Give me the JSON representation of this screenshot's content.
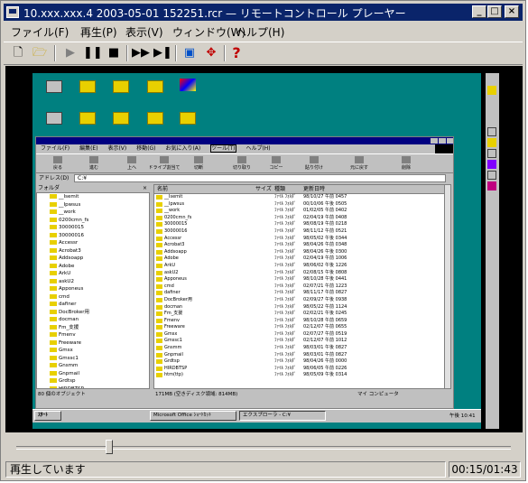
{
  "window": {
    "title": "10.xxx.xxx.4 2003-05-01 152251.rcr — リモートコントロール プレーヤー"
  },
  "menu": [
    "ファイル(F)",
    "再生(P)",
    "表示(V)",
    "ウィンドウ(W)",
    "ヘルプ(H)"
  ],
  "remote": {
    "explorer": {
      "menu": [
        "ファイル(F)",
        "編集(E)",
        "表示(V)",
        "移動(G)",
        "お気に入り(A)",
        "ツール(T)",
        "ヘルプ(H)"
      ],
      "tools": [
        "戻る",
        "進む",
        "上へ",
        "ドライブ割当て",
        "切断",
        "切り取り",
        "コピー",
        "貼り付け",
        "元に戻す",
        "削除"
      ],
      "address_label": "アドレス(D)",
      "address": "C:¥",
      "folder_pane_label": "フォルダ",
      "columns": {
        "name": "名前",
        "size": "サイズ",
        "type": "種類",
        "modified": "更新日時"
      },
      "tree": [
        "__Isemit",
        "__Ipwsus",
        "__work",
        "0200cmn_fs",
        "30000015",
        "30000016",
        "Accessr",
        "Acrobat3",
        "Addsoapp",
        "Adobe",
        "ArkU",
        "askU2",
        "Apponeus",
        "cmd",
        "dafiner",
        "DocBroker用",
        "docman",
        "Fm_支援",
        "Fmenv",
        "Freeware",
        "Gmsx",
        "Gmssc1",
        "Gnsmm",
        "Gnpmail",
        "Grdtsp",
        "HIRDBTSP",
        "htm(ttp)"
      ],
      "files": [
        {
          "name": "__Isemit",
          "type": "ﾌｧｲﾙ ﾌｫﾙﾀﾞ",
          "date": "98/10/27 午前 0457"
        },
        {
          "name": "__Ipwsus",
          "type": "ﾌｧｲﾙ ﾌｫﾙﾀﾞ",
          "date": "00/10/06 午後 0505"
        },
        {
          "name": "__work",
          "type": "ﾌｧｲﾙ ﾌｫﾙﾀﾞ",
          "date": "01/02/05 午前 0402"
        },
        {
          "name": "0200cmn_fs",
          "type": "ﾌｧｲﾙ ﾌｫﾙﾀﾞ",
          "date": "02/04/19 午前 0408"
        },
        {
          "name": "30000015",
          "type": "ﾌｧｲﾙ ﾌｫﾙﾀﾞ",
          "date": "98/08/19 午前 0218"
        },
        {
          "name": "30000016",
          "type": "ﾌｧｲﾙ ﾌｫﾙﾀﾞ",
          "date": "98/11/12 午前 0521"
        },
        {
          "name": "Accessr",
          "type": "ﾌｧｲﾙ ﾌｫﾙﾀﾞ",
          "date": "98/05/02 午後 0344"
        },
        {
          "name": "Acrobat3",
          "type": "ﾌｧｲﾙ ﾌｫﾙﾀﾞ",
          "date": "98/04/26 午前 0348"
        },
        {
          "name": "Addsoapp",
          "type": "ﾌｧｲﾙ ﾌｫﾙﾀﾞ",
          "date": "98/04/26 午後 0300"
        },
        {
          "name": "Adobe",
          "type": "ﾌｧｲﾙ ﾌｫﾙﾀﾞ",
          "date": "02/04/19 午前 1006"
        },
        {
          "name": "ArkU",
          "type": "ﾌｧｲﾙ ﾌｫﾙﾀﾞ",
          "date": "98/06/02 午後 1226"
        },
        {
          "name": "askU2",
          "type": "ﾌｧｲﾙ ﾌｫﾙﾀﾞ",
          "date": "02/08/15 午後 0808"
        },
        {
          "name": "Apponeus",
          "type": "ﾌｧｲﾙ ﾌｫﾙﾀﾞ",
          "date": "98/10/28 午後 0441"
        },
        {
          "name": "cmd",
          "type": "ﾌｧｲﾙ ﾌｫﾙﾀﾞ",
          "date": "02/07/21 午前 1223"
        },
        {
          "name": "dafiner",
          "type": "ﾌｧｲﾙ ﾌｫﾙﾀﾞ",
          "date": "98/11/17 午前 0827"
        },
        {
          "name": "DocBroker用",
          "type": "ﾌｧｲﾙ ﾌｫﾙﾀﾞ",
          "date": "02/09/27 午後 0938"
        },
        {
          "name": "docman",
          "type": "ﾌｧｲﾙ ﾌｫﾙﾀﾞ",
          "date": "98/05/22 午前 1124"
        },
        {
          "name": "Fm_支援",
          "type": "ﾌｧｲﾙ ﾌｫﾙﾀﾞ",
          "date": "02/02/21 午後 0245"
        },
        {
          "name": "Fmenv",
          "type": "ﾌｧｲﾙ ﾌｫﾙﾀﾞ",
          "date": "98/10/28 午前 0659"
        },
        {
          "name": "Freeware",
          "type": "ﾌｧｲﾙ ﾌｫﾙﾀﾞ",
          "date": "02/12/07 午前 0655"
        },
        {
          "name": "Gmsx",
          "type": "ﾌｧｲﾙ ﾌｫﾙﾀﾞ",
          "date": "02/07/27 午前 0519"
        },
        {
          "name": "Gmssc1",
          "type": "ﾌｧｲﾙ ﾌｫﾙﾀﾞ",
          "date": "02/12/07 午前 1012"
        },
        {
          "name": "Gnsmm",
          "type": "ﾌｧｲﾙ ﾌｫﾙﾀﾞ",
          "date": "98/03/01 午後 0827"
        },
        {
          "name": "Gnpmail",
          "type": "ﾌｧｲﾙ ﾌｫﾙﾀﾞ",
          "date": "98/03/01 午前 0827"
        },
        {
          "name": "Grdtsp",
          "type": "ﾌｧｲﾙ ﾌｫﾙﾀﾞ",
          "date": "98/04/26 午前 0000"
        },
        {
          "name": "HIRDBTSP",
          "type": "ﾌｧｲﾙ ﾌｫﾙﾀﾞ",
          "date": "98/06/05 午前 0226"
        },
        {
          "name": "htm(ttp)",
          "type": "ﾌｧｲﾙ ﾌｫﾙﾀﾞ",
          "date": "98/05/09 午後 0314"
        }
      ],
      "status_left": "80 個のオブジェクト",
      "status_mid": "171MB (空きディスク領域: 814MB)",
      "status_right": "マイ コンピュータ"
    },
    "taskbar": {
      "start": "ｽﾀｰﾄ",
      "items": [
        "Microsoft Office ｼｮｰﾄｶｯﾄ",
        "エクスプローラ - C:¥"
      ],
      "clock": "午後 10:41"
    }
  },
  "seek_position": 0.18,
  "status": {
    "text": "再生しています",
    "time": "00:15/01:43"
  }
}
